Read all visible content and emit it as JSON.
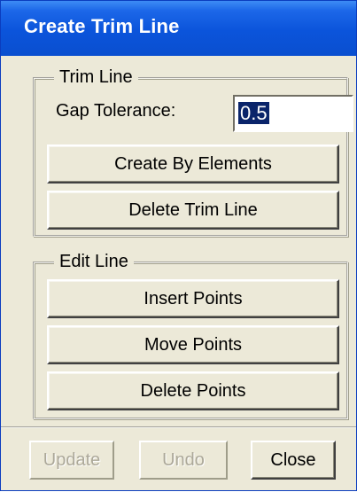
{
  "window": {
    "title": "Create Trim Line"
  },
  "trim_line_group": {
    "label": "Trim Line",
    "gap_tolerance_label": "Gap Tolerance:",
    "gap_tolerance_value": "0.5",
    "buttons": {
      "create_by_elements": "Create By Elements",
      "delete_trim_line": "Delete Trim Line"
    }
  },
  "edit_line_group": {
    "label": "Edit Line",
    "buttons": {
      "insert_points": "Insert Points",
      "move_points": "Move Points",
      "delete_points": "Delete Points"
    }
  },
  "footer": {
    "update": {
      "label": "Update",
      "enabled": false
    },
    "undo": {
      "label": "Undo",
      "enabled": false
    },
    "close": {
      "label": "Close",
      "enabled": true
    }
  },
  "colors": {
    "title_bar": "#0b54db",
    "dialog_background": "#ece9d8",
    "selection_highlight": "#0a246a",
    "disabled_text": "#aca899"
  }
}
